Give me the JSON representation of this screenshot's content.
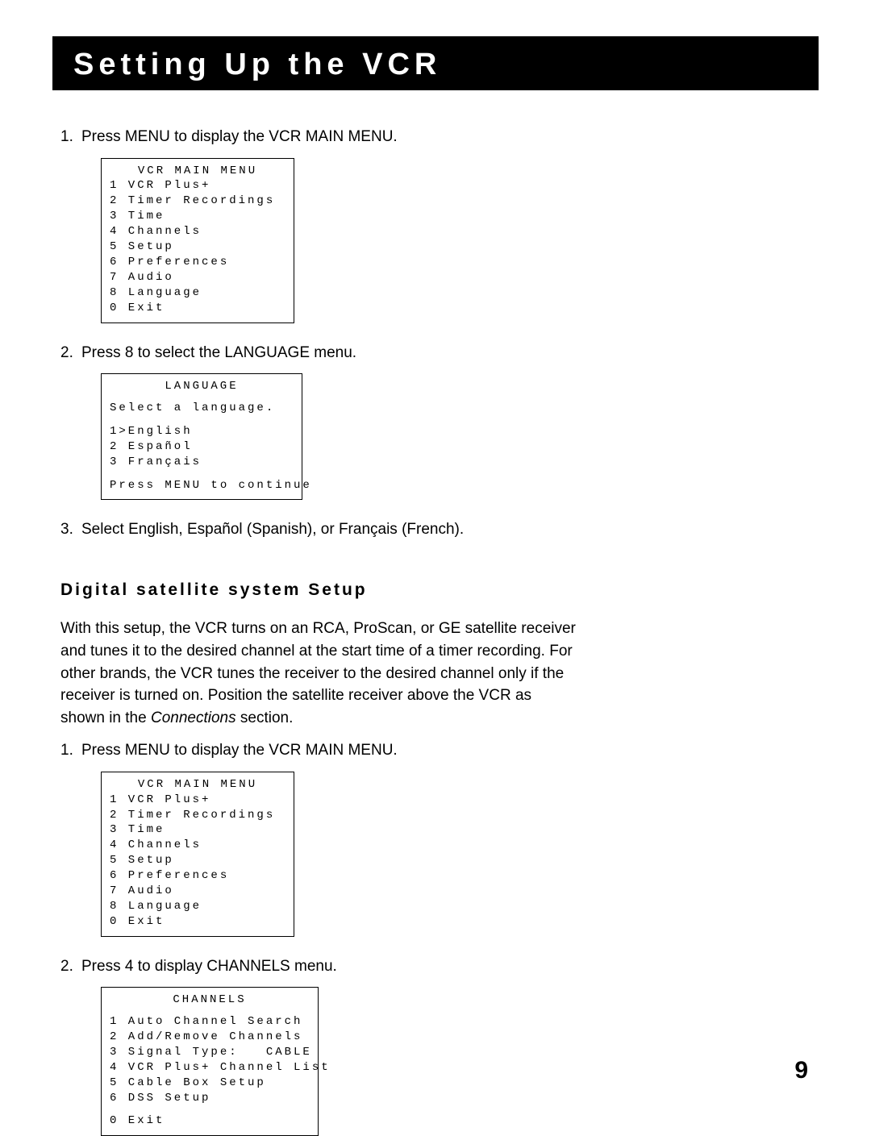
{
  "title": "Setting Up the VCR",
  "steps": {
    "s1": {
      "num": "1.",
      "text": "Press MENU to display the VCR MAIN MENU."
    },
    "s2": {
      "num": "2.",
      "text": "Press 8 to select the LANGUAGE menu."
    },
    "s3": {
      "num": "3.",
      "text": "Select English, Español (Spanish), or Français (French)."
    },
    "s4": {
      "num": "1.",
      "text": "Press MENU to display the VCR MAIN MENU."
    },
    "s5": {
      "num": "2.",
      "text": "Press 4 to display CHANNELS menu."
    }
  },
  "vcr_menu": {
    "title": "VCR MAIN MENU",
    "i1": "1 VCR Plus+",
    "i2": "2 Timer Recordings",
    "i3": "3 Time",
    "i4": "4 Channels",
    "i5": "5 Setup",
    "i6": "6 Preferences",
    "i7": "7 Audio",
    "i8": "8 Language",
    "i0": "0 Exit"
  },
  "lang_menu": {
    "title": "LANGUAGE",
    "sub": "Select a language.",
    "i1": "1>English",
    "i2": "2 Español",
    "i3": "3 Français",
    "footer": "Press MENU to continue"
  },
  "section_heading": "Digital satellite system Setup",
  "dss_para_a": "With this setup, the VCR turns on an RCA, ProScan, or GE satellite receiver and tunes it to the desired channel at the start time of a timer recording. For other brands, the VCR tunes the receiver to the desired channel only if the receiver is turned on. Position the satellite receiver above the VCR as shown in the ",
  "dss_para_italic": "Connections",
  "dss_para_b": " section.",
  "channels_menu": {
    "title": "CHANNELS",
    "i1": "1 Auto Channel Search",
    "i2": "2 Add/Remove Channels",
    "i3": "3 Signal Type:   CABLE",
    "i4": "4 VCR Plus+ Channel List",
    "i5": "5 Cable Box Setup",
    "i6": "6 DSS Setup",
    "i0": "0 Exit"
  },
  "page_number": "9"
}
